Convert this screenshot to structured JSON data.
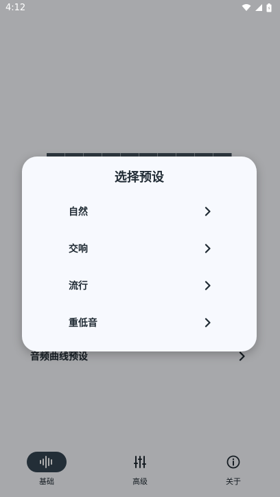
{
  "status_bar": {
    "time": "4:12"
  },
  "dialog": {
    "title": "选择预设",
    "options": [
      {
        "label": "自然"
      },
      {
        "label": "交响"
      },
      {
        "label": "流行"
      },
      {
        "label": "重低音"
      }
    ]
  },
  "background": {
    "preset_row_label": "音频曲线预设"
  },
  "bottom_nav": {
    "items": [
      {
        "label": "基础",
        "icon": "waveform-icon",
        "active": true
      },
      {
        "label": "高级",
        "icon": "sliders-icon",
        "active": false
      },
      {
        "label": "关于",
        "icon": "info-icon",
        "active": false
      }
    ]
  },
  "colors": {
    "accent": "#344452",
    "scrim": "#000000",
    "dialog_bg": "#f7f9fe"
  }
}
